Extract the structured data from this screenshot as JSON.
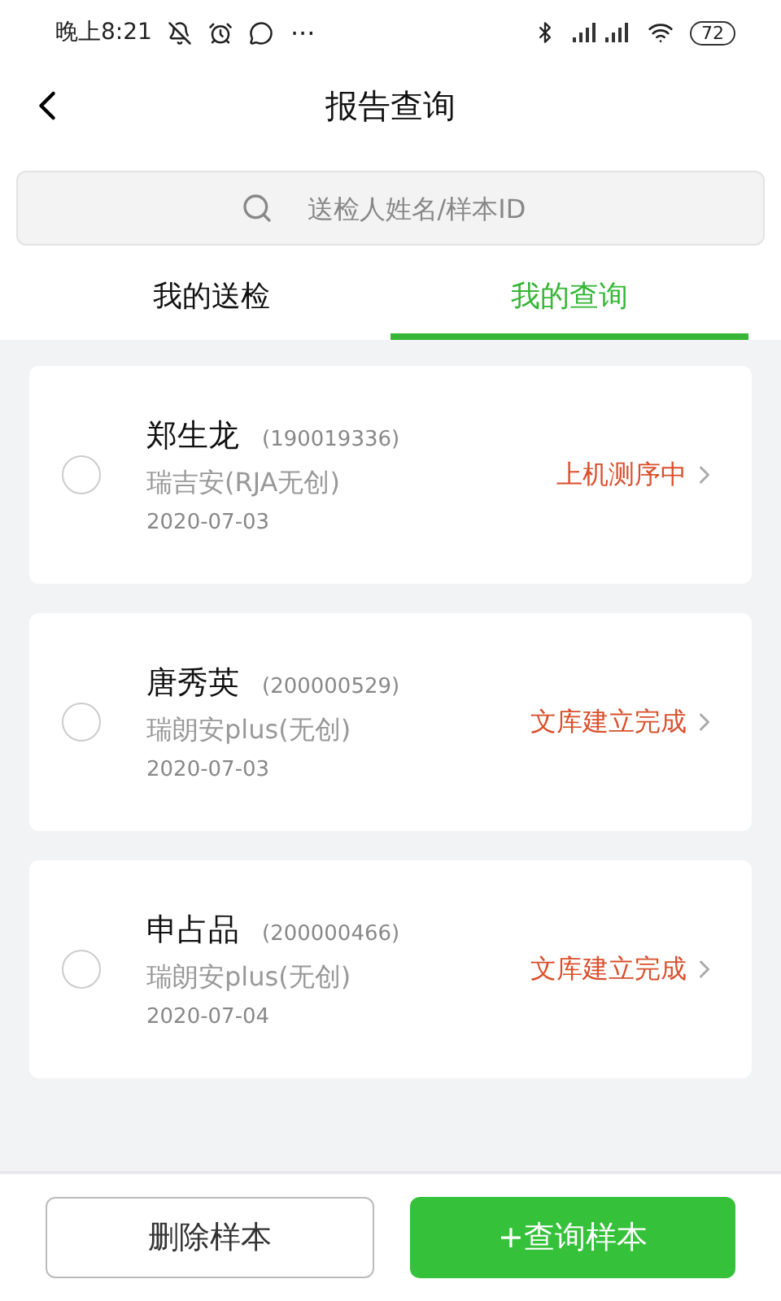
{
  "status_bar": {
    "time": "晚上8:21",
    "more": "···",
    "battery": "72"
  },
  "header": {
    "title": "报告查询"
  },
  "search": {
    "placeholder": "送检人姓名/样本ID"
  },
  "tabs": [
    {
      "label": "我的送检",
      "selected": false
    },
    {
      "label": "我的查询",
      "selected": true
    }
  ],
  "samples": [
    {
      "name": "郑生龙",
      "id": "(190019336)",
      "product": "瑞吉安(RJA无创)",
      "date": "2020-07-03",
      "status": "上机测序中",
      "checked": false
    },
    {
      "name": "唐秀英",
      "id": "(200000529)",
      "product": "瑞朗安plus(无创)",
      "date": "2020-07-03",
      "status": "文库建立完成",
      "checked": false
    },
    {
      "name": "申占品",
      "id": "(200000466)",
      "product": "瑞朗安plus(无创)",
      "date": "2020-07-04",
      "status": "文库建立完成",
      "checked": false
    }
  ],
  "buttons": [
    {
      "label": "删除样本",
      "kind": "outline"
    },
    {
      "label": "+查询样本",
      "kind": "primary"
    }
  ]
}
